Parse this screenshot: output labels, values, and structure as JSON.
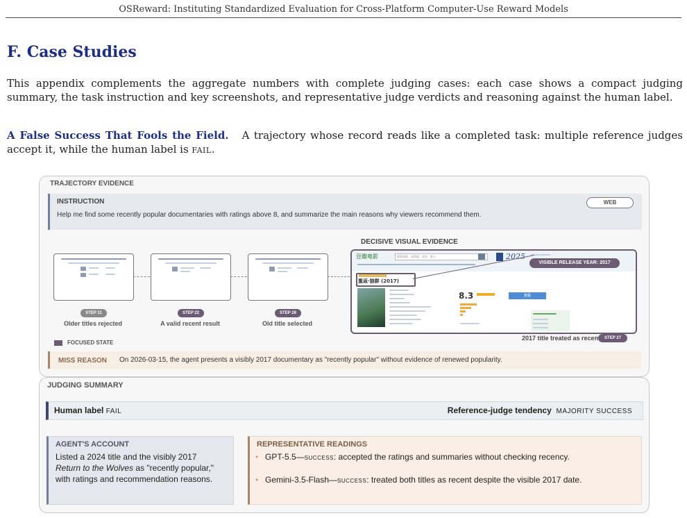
{
  "running_header": "OSReward: Instituting Standardized Evaluation for Cross-Platform Computer-Use Reward Models",
  "section_title": "F.  Case Studies",
  "intro": "This appendix complements the aggregate numbers with complete judging cases: each case shows a compact judging summary, the task instruction and key screenshots, and representative judge verdicts and reasoning against the human label.",
  "case": {
    "title": "A False Success That Fools the Field.",
    "text_before": "A trajectory whose record reads like a completed task: multiple reference judges accept it, while the human label is ",
    "label": "fail",
    "text_after": "."
  },
  "figure": {
    "trajectory_evidence": "TRAJECTORY EVIDENCE",
    "instruction_caption": "INSTRUCTION",
    "platform_badge": "WEB",
    "instruction_text": "Help me find some recently popular documentaries with ratings above 8, and summarize the main reasons why viewers recommend them.",
    "decisive_caption": "DECISIVE VISUAL EVIDENCE",
    "steps": [
      {
        "badge": "STEP 11",
        "label": "Older titles rejected"
      },
      {
        "badge": "STEP 22",
        "label": "A valid recent result"
      },
      {
        "badge": "STEP 28",
        "label": "Old title selected"
      }
    ],
    "evidence_badge": "VISIBLE RELEASE YEAR: 2017",
    "evidence_label": "2017 title treated as recent",
    "evidence_step": "STEP 27",
    "focused_state": "FOCUSED STATE",
    "miss_reason_caption": "MISS REASON",
    "miss_reason_text": "On 2026-03-15, the agent presents a visibly 2017 documentary as \"recently popular\" without evidence of renewed popularity.",
    "judging_summary": "JUDGING SUMMARY",
    "human_label_caption": "Human label",
    "human_label_value": "FAIL",
    "tendency_caption": "Reference-judge tendency",
    "tendency_value": "MAJORITY SUCCESS",
    "agent_account_caption": "AGENT'S ACCOUNT",
    "agent_account_pre": "Listed a 2024 title and the visibly 2017 ",
    "agent_account_italic": "Return to the Wolves",
    "agent_account_post": " as \"recently popular,\" with ratings and recommendation reasons.",
    "readings_caption": "REPRESENTATIVE READINGS",
    "readings": [
      {
        "model": "GPT-5.5",
        "verdict": "success",
        "text": ": accepted the ratings and summaries without checking recency."
      },
      {
        "model": "Gemini-3.5-Flash",
        "verdict": "success",
        "text": ": treated both titles as recent despite the visible 2017 date."
      }
    ],
    "screenshot": {
      "site_logo": "豆瓣电影",
      "search_placeholder": "搜索电影、电视剧、综艺、影人",
      "year_banner": "2025",
      "movie_title": "重返·狼群 (2017)",
      "rating": "8.3",
      "button": "想看"
    },
    "colors": {
      "accent": "#1f2f80",
      "step_badge": "#6b5c74",
      "miss_bg": "#f8efe4",
      "miss_bar": "#a6866b",
      "readings_bg": "#f9efe6",
      "account_bg": "#e4e8ee"
    }
  }
}
